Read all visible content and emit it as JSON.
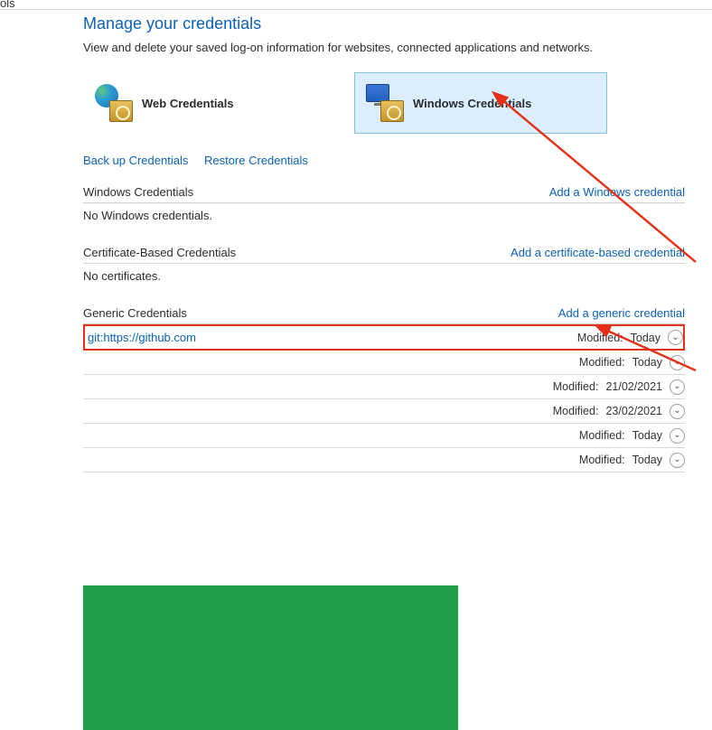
{
  "sidebar": {
    "label": "ols"
  },
  "header": {
    "title": "Manage your credentials",
    "subtitle": "View and delete your saved log-on information for websites, connected applications and networks."
  },
  "tabs": {
    "web": "Web Credentials",
    "windows": "Windows Credentials"
  },
  "actions": {
    "backup": "Back up Credentials",
    "restore": "Restore Credentials"
  },
  "sections": {
    "windows": {
      "title": "Windows Credentials",
      "add": "Add a Windows credential",
      "empty": "No Windows credentials."
    },
    "cert": {
      "title": "Certificate-Based Credentials",
      "add": "Add a certificate-based credential",
      "empty": "No certificates."
    },
    "generic": {
      "title": "Generic Credentials",
      "add": "Add a generic credential"
    }
  },
  "modified_label": "Modified:",
  "credentials": [
    {
      "name": "git:https://github.com",
      "modified": "Today"
    },
    {
      "name": "",
      "modified": "Today"
    },
    {
      "name": "",
      "modified": "21/02/2021"
    },
    {
      "name": "",
      "modified": "23/02/2021"
    },
    {
      "name": "",
      "modified": "Today"
    },
    {
      "name": "",
      "modified": "Today"
    }
  ]
}
